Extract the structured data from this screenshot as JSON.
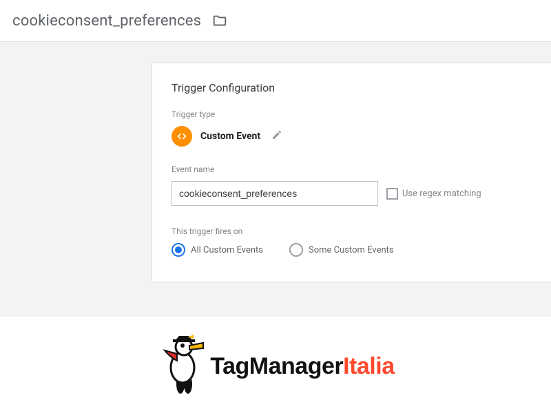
{
  "header": {
    "title": "cookieconsent_preferences"
  },
  "panel": {
    "heading": "Trigger Configuration",
    "trigger_type_label": "Trigger type",
    "trigger_type_name": "Custom Event",
    "event_name_label": "Event name",
    "event_name_value": "cookieconsent_preferences",
    "regex_label": "Use regex matching",
    "fires_on_label": "This trigger fires on",
    "radio_all": "All Custom Events",
    "radio_some": "Some Custom Events"
  },
  "logo": {
    "part1": "TagManager",
    "part2": "Italia"
  }
}
